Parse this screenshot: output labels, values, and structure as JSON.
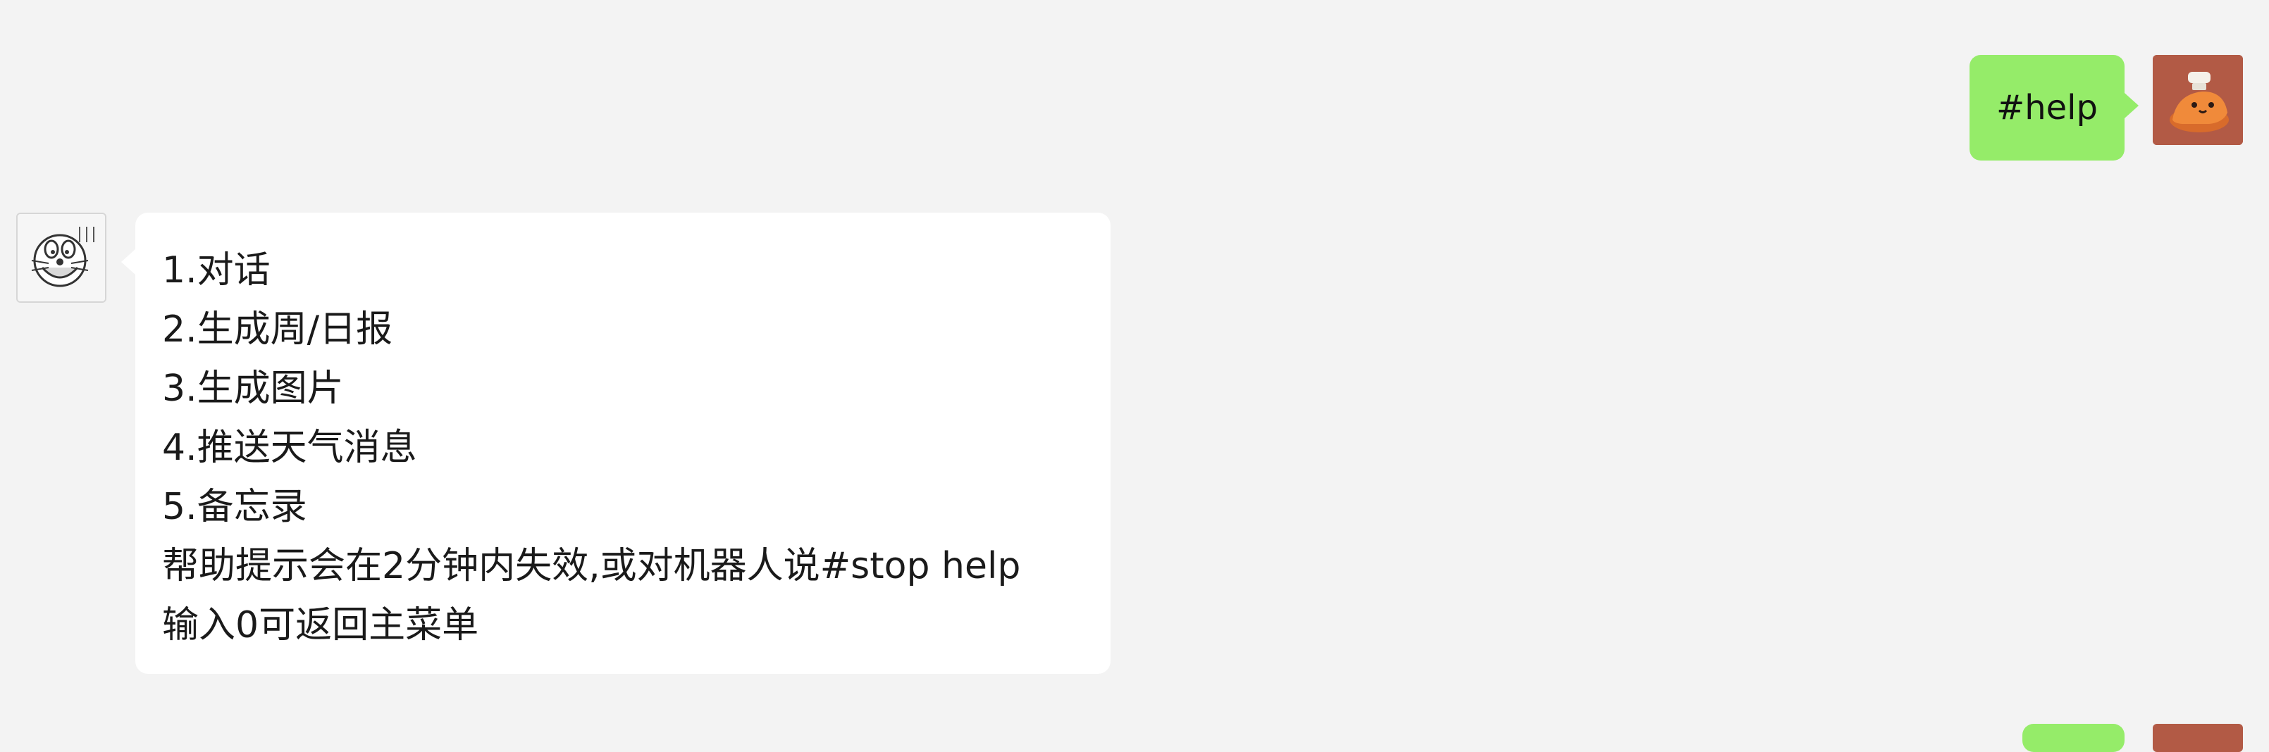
{
  "messages": [
    {
      "direction": "outgoing",
      "text": "#help",
      "avatar_icon": "dinosaur-chef-avatar"
    },
    {
      "direction": "incoming",
      "avatar_icon": "doraemon-avatar",
      "lines": [
        "1.对话",
        "2.生成周/日报",
        "3.生成图片",
        "4.推送天气消息",
        "5.备忘录",
        "帮助提示会在2分钟内失效,或对机器人说#stop help",
        "输入0可返回主菜单"
      ]
    },
    {
      "direction": "outgoing",
      "text": "",
      "avatar_icon": "dinosaur-chef-avatar",
      "partially_visible": true
    }
  ],
  "colors": {
    "background": "#f3f3f3",
    "outgoing_bubble": "#95ec69",
    "incoming_bubble": "#ffffff",
    "user_avatar": "#b25a45"
  }
}
